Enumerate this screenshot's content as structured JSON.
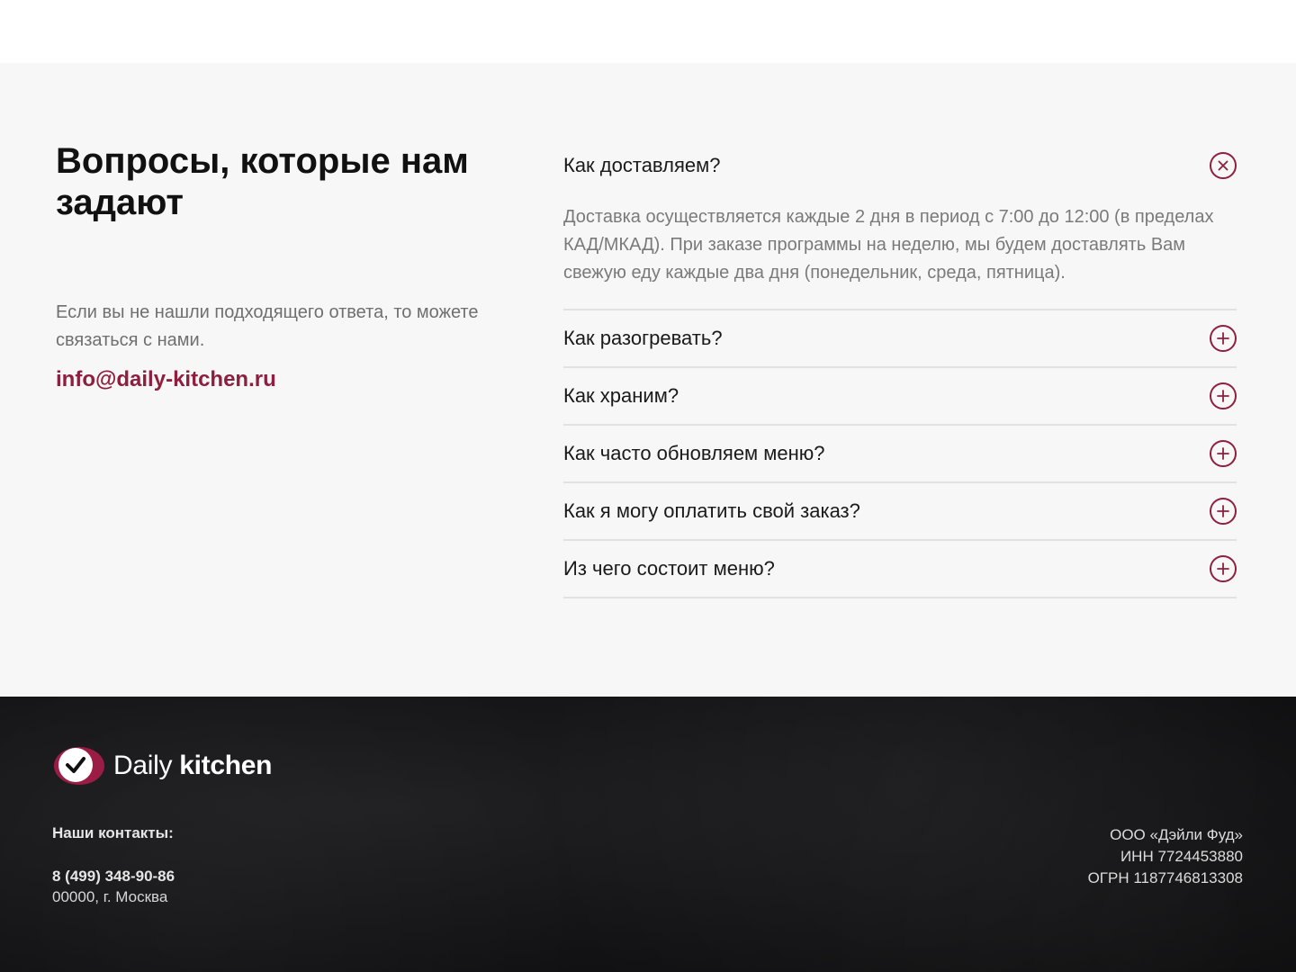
{
  "faq": {
    "title": "Вопросы, которые нам задают",
    "note": "Если вы не нашли подходящего ответа, то можете связаться с нами.",
    "email": "info@daily-kitchen.ru",
    "items": [
      {
        "question": "Как доставляем?",
        "answer": "Доставка осуществляется каждые 2 дня в период с 7:00 до 12:00 (в пределах КАД/МКАД). При заказе программы на неделю, мы будем доставлять Вам свежую еду каждые два дня (понедельник, среда, пятница).",
        "open": true
      },
      {
        "question": "Как разогревать?",
        "open": false
      },
      {
        "question": "Как храним?",
        "open": false
      },
      {
        "question": "Как часто обновляем меню?",
        "open": false
      },
      {
        "question": "Как я могу оплатить свой заказ?",
        "open": false
      },
      {
        "question": "Из чего состоит меню?",
        "open": false
      }
    ],
    "icons": {
      "open": "close-circle-icon",
      "closed": "plus-circle-icon"
    },
    "accent_color": "#8e1f3e"
  },
  "footer": {
    "logo": {
      "word1": "Daily",
      "word2": "kitchen",
      "icon": "checkmark-logo-icon"
    },
    "contacts_label": "Наши контакты:",
    "phone": "8 (499) 348-90-86",
    "address": "00000, г. Москва",
    "legal": {
      "company": "ООО «Дэйли Фуд»",
      "inn": "ИНН 7724453880",
      "ogrn": "ОГРН 1187746813308"
    }
  }
}
